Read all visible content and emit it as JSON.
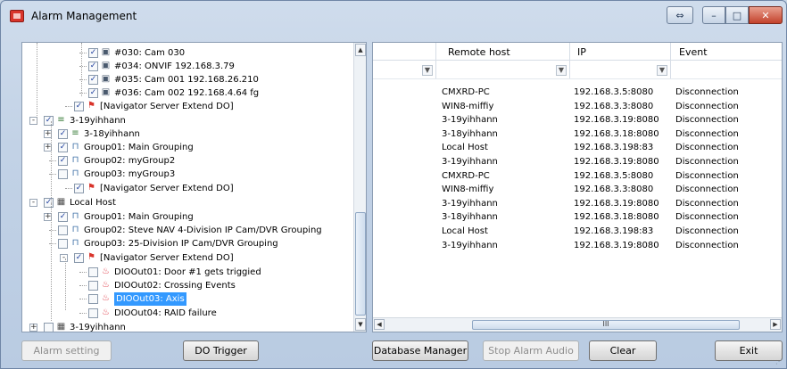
{
  "window": {
    "title": "Alarm Management"
  },
  "tree": [
    {
      "label": "#030: Cam 030",
      "icon": "camera-icon",
      "checked": true
    },
    {
      "label": "#034: ONVIF 192.168.3.79",
      "icon": "camera-icon",
      "checked": true
    },
    {
      "label": "#035: Cam 001 192.168.26.210",
      "icon": "camera-icon",
      "checked": true
    },
    {
      "label": "#036: Cam 002 192.168.4.64 fg",
      "icon": "camera-icon",
      "checked": true
    },
    {
      "label": "[Navigator Server Extend DO]",
      "icon": "flag-icon",
      "checked": true
    },
    {
      "label": "3-19yihhann",
      "icon": "server-icon",
      "checked": true,
      "expander": "-"
    },
    {
      "label": "3-18yihhann",
      "icon": "server-icon",
      "checked": true,
      "expander": "+"
    },
    {
      "label": "Group01: Main Grouping",
      "icon": "group-icon",
      "checked": true,
      "expander": "+"
    },
    {
      "label": "Group02: myGroup2",
      "icon": "group-icon",
      "checked": true
    },
    {
      "label": "Group03: myGroup3",
      "icon": "group-icon",
      "checked": false
    },
    {
      "label": "[Navigator Server Extend DO]",
      "icon": "flag-icon",
      "checked": true
    },
    {
      "label": "Local Host",
      "icon": "host-icon",
      "checked": true,
      "expander": "-"
    },
    {
      "label": "Group01: Main Grouping",
      "icon": "group-icon",
      "checked": true,
      "expander": "+"
    },
    {
      "label": "Group02: Steve NAV 4-Division IP Cam/DVR Grouping",
      "icon": "group-icon",
      "checked": false
    },
    {
      "label": "Group03: 25-Division IP Cam/DVR Grouping",
      "icon": "group-icon",
      "checked": false
    },
    {
      "label": "[Navigator Server Extend DO]",
      "icon": "flag-icon",
      "checked": true,
      "expander": "-"
    },
    {
      "label": "DIOOut01: Door #1 gets triggied",
      "icon": "dio-icon",
      "checked": false
    },
    {
      "label": "DIOOut02: Crossing Events",
      "icon": "dio-icon",
      "checked": false
    },
    {
      "label": "DIOOut03: Axis",
      "icon": "dio-icon",
      "checked": false,
      "selected": true
    },
    {
      "label": "DIOOut04: RAID failure",
      "icon": "dio-icon",
      "checked": false
    },
    {
      "label": "3-19yihhann",
      "icon": "host-icon",
      "checked": false,
      "expander": "+"
    }
  ],
  "grid": {
    "headers": [
      "Remote host",
      "IP",
      "Event"
    ],
    "rows": [
      [
        "CMXRD-PC",
        "192.168.3.5:8080",
        "Disconnection"
      ],
      [
        "WIN8-miffiy",
        "192.168.3.3:8080",
        "Disconnection"
      ],
      [
        "3-19yihhann",
        "192.168.3.19:8080",
        "Disconnection"
      ],
      [
        "3-18yihhann",
        "192.168.3.18:8080",
        "Disconnection"
      ],
      [
        "Local Host",
        "192.168.3.198:83",
        "Disconnection"
      ],
      [
        "3-19yihhann",
        "192.168.3.19:8080",
        "Disconnection"
      ],
      [
        "CMXRD-PC",
        "192.168.3.5:8080",
        "Disconnection"
      ],
      [
        "WIN8-miffiy",
        "192.168.3.3:8080",
        "Disconnection"
      ],
      [
        "3-19yihhann",
        "192.168.3.19:8080",
        "Disconnection"
      ],
      [
        "3-18yihhann",
        "192.168.3.18:8080",
        "Disconnection"
      ],
      [
        "Local Host",
        "192.168.3.198:83",
        "Disconnection"
      ],
      [
        "3-19yihhann",
        "192.168.3.19:8080",
        "Disconnection"
      ]
    ],
    "hscroll_label": "III"
  },
  "buttons": {
    "alarm_setting": "Alarm setting",
    "do_trigger": "DO Trigger",
    "database_manager": "Database Manager",
    "stop_alarm_audio": "Stop Alarm Audio",
    "clear": "Clear",
    "exit": "Exit"
  },
  "colors": {
    "selection": "#3399ff",
    "flag": "#d9342b",
    "dio": "#e0434f"
  }
}
